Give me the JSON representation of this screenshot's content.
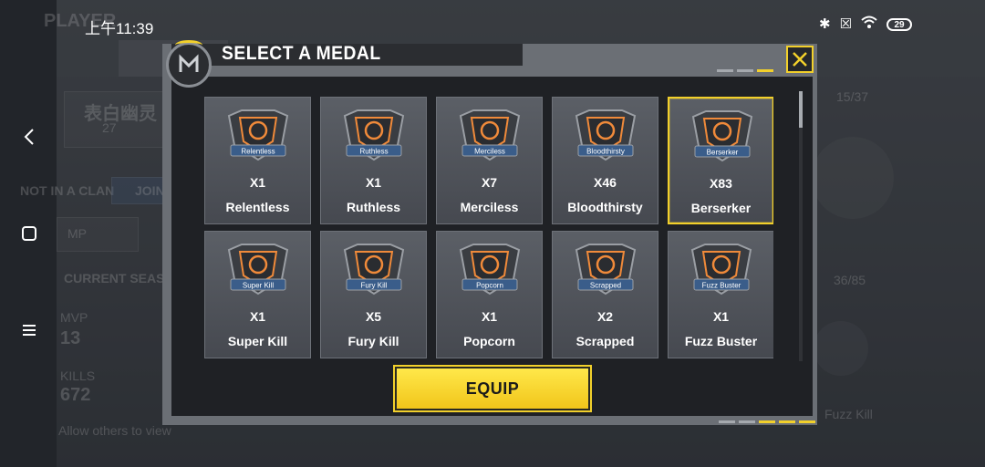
{
  "status_bar": {
    "time": "上午11:39",
    "battery": "29"
  },
  "background": {
    "player_label": "PLAYER",
    "player_name": "表白幽灵",
    "level": "27",
    "clan": "NOT IN A CLAN",
    "join": "JOIN",
    "mp": "MP",
    "season": "CURRENT SEASON",
    "mvp_label": "MVP",
    "mvp_value": "13",
    "kills_label": "KILLS",
    "kills_value": "672",
    "allow_text": "Allow others to view",
    "count1": "15/37",
    "count2": "36/85",
    "fuzz_text": "Fuzz Kill"
  },
  "dialog": {
    "title": "SELECT A MEDAL",
    "equip_label": "EQUIP",
    "medals": [
      {
        "badge": "Relentless",
        "count": "X1",
        "name": "Relentless",
        "selected": false
      },
      {
        "badge": "Ruthless",
        "count": "X1",
        "name": "Ruthless",
        "selected": false
      },
      {
        "badge": "Merciless",
        "count": "X7",
        "name": "Merciless",
        "selected": false
      },
      {
        "badge": "Bloodthirsty",
        "count": "X46",
        "name": "Bloodthirsty",
        "selected": false
      },
      {
        "badge": "Berserker",
        "count": "X83",
        "name": "Berserker",
        "selected": true
      },
      {
        "badge": "Super Kill",
        "count": "X1",
        "name": "Super Kill",
        "selected": false
      },
      {
        "badge": "Fury Kill",
        "count": "X5",
        "name": "Fury Kill",
        "selected": false
      },
      {
        "badge": "Popcorn",
        "count": "X1",
        "name": "Popcorn",
        "selected": false
      },
      {
        "badge": "Scrapped",
        "count": "X2",
        "name": "Scrapped",
        "selected": false
      },
      {
        "badge": "Fuzz Buster",
        "count": "X1",
        "name": "Fuzz Buster",
        "selected": false
      }
    ]
  },
  "colors": {
    "accent": "#f2d02b",
    "dialog_bg": "#1f2125",
    "card_bg": "#53575e",
    "medal_orange": "#f08a3a",
    "badge_blue": "#3a5d8a"
  }
}
